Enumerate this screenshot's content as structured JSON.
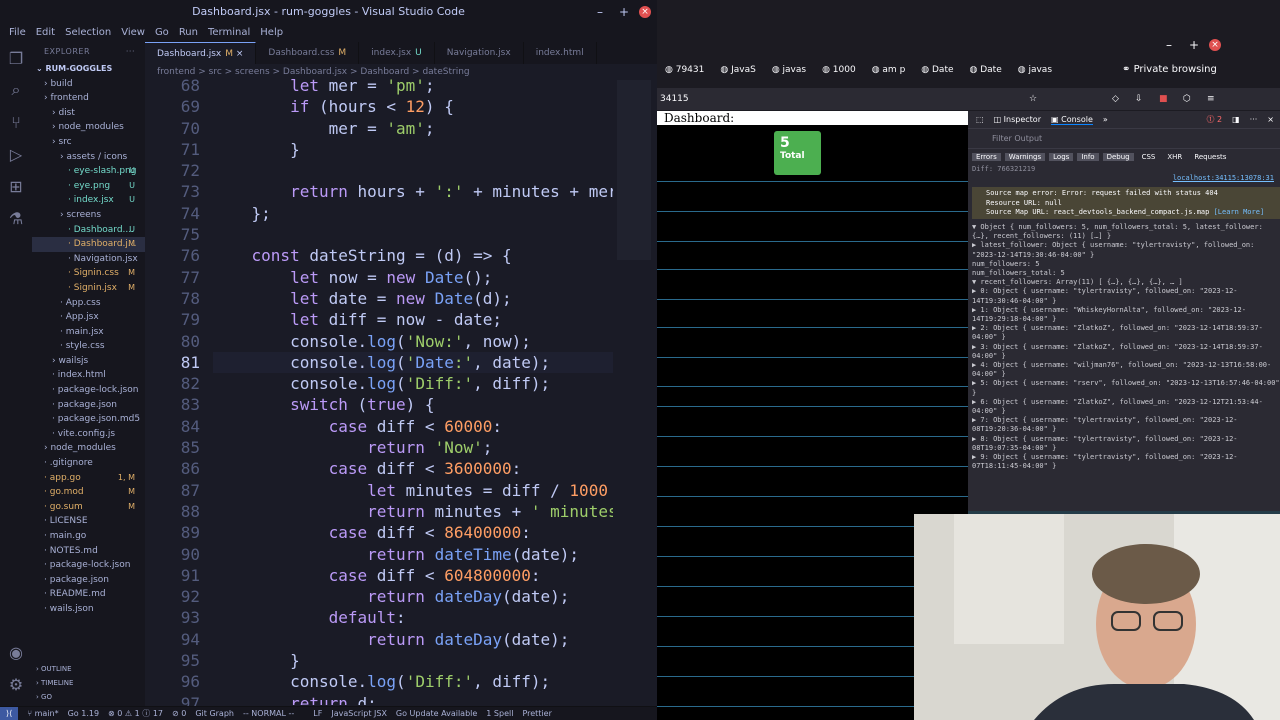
{
  "vscode": {
    "title": "Dashboard.jsx - rum-goggles - Visual Studio Code",
    "menu": [
      "File",
      "Edit",
      "Selection",
      "View",
      "Go",
      "Run",
      "Terminal",
      "Help"
    ],
    "explorer": {
      "header": "EXPLORER",
      "root": "RUM-GOGGLES",
      "items": [
        {
          "label": "build",
          "indent": 1
        },
        {
          "label": "frontend",
          "indent": 1
        },
        {
          "label": "dist",
          "indent": 2
        },
        {
          "label": "node_modules",
          "indent": 2
        },
        {
          "label": "src",
          "indent": 2
        },
        {
          "label": "assets / icons",
          "indent": 3
        },
        {
          "label": "eye-slash.png",
          "indent": 4,
          "badge": "U"
        },
        {
          "label": "eye.png",
          "indent": 4,
          "badge": "U"
        },
        {
          "label": "index.jsx",
          "indent": 4,
          "badge": "U"
        },
        {
          "label": "screens",
          "indent": 3
        },
        {
          "label": "Dashboard....",
          "indent": 4,
          "badge": "U"
        },
        {
          "label": "Dashboard.j...",
          "indent": 4,
          "badge": "M"
        },
        {
          "label": "Navigation.jsx",
          "indent": 4
        },
        {
          "label": "Signin.css",
          "indent": 4,
          "badge": "M"
        },
        {
          "label": "Signin.jsx",
          "indent": 4,
          "badge": "M"
        },
        {
          "label": "App.css",
          "indent": 3
        },
        {
          "label": "App.jsx",
          "indent": 3
        },
        {
          "label": "main.jsx",
          "indent": 3
        },
        {
          "label": "style.css",
          "indent": 3
        },
        {
          "label": "wailsjs",
          "indent": 2
        },
        {
          "label": "index.html",
          "indent": 2
        },
        {
          "label": "package-lock.json",
          "indent": 2
        },
        {
          "label": "package.json",
          "indent": 2
        },
        {
          "label": "package.json.md5",
          "indent": 2
        },
        {
          "label": "vite.config.js",
          "indent": 2
        },
        {
          "label": "node_modules",
          "indent": 1
        },
        {
          "label": ".gitignore",
          "indent": 1
        },
        {
          "label": "app.go",
          "indent": 1,
          "badge": "1, M"
        },
        {
          "label": "go.mod",
          "indent": 1,
          "badge": "M"
        },
        {
          "label": "go.sum",
          "indent": 1,
          "badge": "M"
        },
        {
          "label": "LICENSE",
          "indent": 1
        },
        {
          "label": "main.go",
          "indent": 1
        },
        {
          "label": "NOTES.md",
          "indent": 1
        },
        {
          "label": "package-lock.json",
          "indent": 1
        },
        {
          "label": "package.json",
          "indent": 1
        },
        {
          "label": "README.md",
          "indent": 1
        },
        {
          "label": "wails.json",
          "indent": 1
        }
      ],
      "outline": "OUTLINE",
      "timeline": "TIMELINE",
      "go": "GO"
    },
    "tabs": [
      {
        "label": "Dashboard.jsx",
        "badge": "M",
        "active": true
      },
      {
        "label": "Dashboard.css",
        "badge": "M"
      },
      {
        "label": "index.jsx",
        "badge": "U"
      },
      {
        "label": "Navigation.jsx"
      },
      {
        "label": "index.html"
      }
    ],
    "breadcrumb": "frontend > src > screens > Dashboard.jsx > Dashboard > dateString",
    "line_numbers": [
      "68",
      "69",
      "70",
      "71",
      "72",
      "73",
      "74",
      "75",
      "76",
      "77",
      "78",
      "79",
      "80",
      "81",
      "82",
      "83",
      "84",
      "85",
      "86",
      "87",
      "88",
      "89",
      "90",
      "91",
      "92",
      "93",
      "94",
      "95",
      "96",
      "97"
    ],
    "code_lines": [
      "        let mer = 'pm';",
      "        if (hours < 12) {",
      "            mer = 'am';",
      "        }",
      "",
      "        return hours + ':' + minutes + mer",
      "    };",
      "",
      "    const dateString = (d) => {",
      "        let now = new Date();",
      "        let date = new Date(d);",
      "        let diff = now - date;",
      "        console.log('Now:', now);",
      "        console.log('Date:', date);",
      "        console.log('Diff:', diff);",
      "        switch (true) {",
      "            case diff < 60000:",
      "                return 'Now';",
      "            case diff < 3600000:",
      "                let minutes = diff / 1000",
      "                return minutes + ' minutes",
      "            case diff < 86400000:",
      "                return dateTime(date);",
      "            case diff < 604800000:",
      "                return dateDay(date);",
      "            default:",
      "                return dateDay(date);",
      "        }",
      "        console.log('Diff:', diff);",
      "        return d;"
    ],
    "status": {
      "branch": "main*",
      "go_version": "Go 1.19",
      "problems": "⊗ 0 ⚠ 1 ⓘ 17",
      "ports": "⊘ 0",
      "git_graph": "Git Graph",
      "vim_mode": "-- NORMAL --",
      "eol": "LF",
      "lang": "JavaScript JSX",
      "go_update": "Go Update Available",
      "spell": "1 Spell",
      "prettier": "Prettier"
    }
  },
  "browser": {
    "tabs": [
      "79431",
      "JavaS",
      "javas",
      "1000",
      "am p",
      "Date",
      "Date",
      "javas"
    ],
    "private": "Private browsing",
    "url": "34115",
    "page": {
      "title": "Dashboard:",
      "counter_value": "5",
      "counter_label": "Total"
    },
    "devtools": {
      "tabs": [
        "Inspector",
        "Console"
      ],
      "errors_count": "2",
      "filter_placeholder": "Filter Output",
      "categories": [
        "Errors",
        "Warnings",
        "Logs",
        "Info",
        "Debug",
        "CSS",
        "XHR",
        "Requests"
      ],
      "diff_line": "Diff: 766321219",
      "source_link": "localhost:34115:13078:31",
      "error_lines": [
        "Source map error: Error: request failed with status 404",
        "Resource URL: null",
        "Source Map URL: react_devtools_backend_compact.js.map"
      ],
      "learn_more": "[Learn More]",
      "object_lines": [
        "▼ Object { num_followers: 5, num_followers_total: 5, latest_follower: {…}, recent_followers: (11) […] }",
        "  ▶ latest_follower: Object { username: \"tylertravisty\", followed_on: \"2023-12-14T19:30:46-04:00\" }",
        "    num_followers: 5",
        "    num_followers_total: 5",
        "  ▼ recent_followers: Array(11) [ {…}, {…}, {…}, … ]",
        "    ▶ 0: Object { username: \"tylertravisty\", followed_on: \"2023-12-14T19:30:46-04:00\" }",
        "    ▶ 1: Object { username: \"WhiskeyHornAlta\", followed_on: \"2023-12-14T19:29:18-04:00\" }",
        "    ▶ 2: Object { username: \"ZlatkoZ\", followed_on: \"2023-12-14T18:59:37-04:00\" }",
        "    ▶ 3: Object { username: \"ZlatkoZ\", followed_on: \"2023-12-14T18:59:37-04:00\" }",
        "    ▶ 4: Object { username: \"wiljman76\", followed_on: \"2023-12-13T16:58:00-04:00\" }",
        "    ▶ 5: Object { username: \"rserv\", followed_on: \"2023-12-13T16:57:46-04:00\" }",
        "    ▶ 6: Object { username: \"ZlatkoZ\", followed_on: \"2023-12-12T21:53:44-04:00\" }",
        "    ▶ 7: Object { username: \"tylertravisty\", followed_on: \"2023-12-08T19:20:36-04:00\" }",
        "    ▶ 8: Object { username: \"tylertravisty\", followed_on: \"2023-12-08T19:07:35-04:00\" }",
        "    ▶ 9: Object { username: \"tylertravisty\", followed_on: \"2023-12-07T18:11:45-04:00\" }"
      ]
    }
  }
}
